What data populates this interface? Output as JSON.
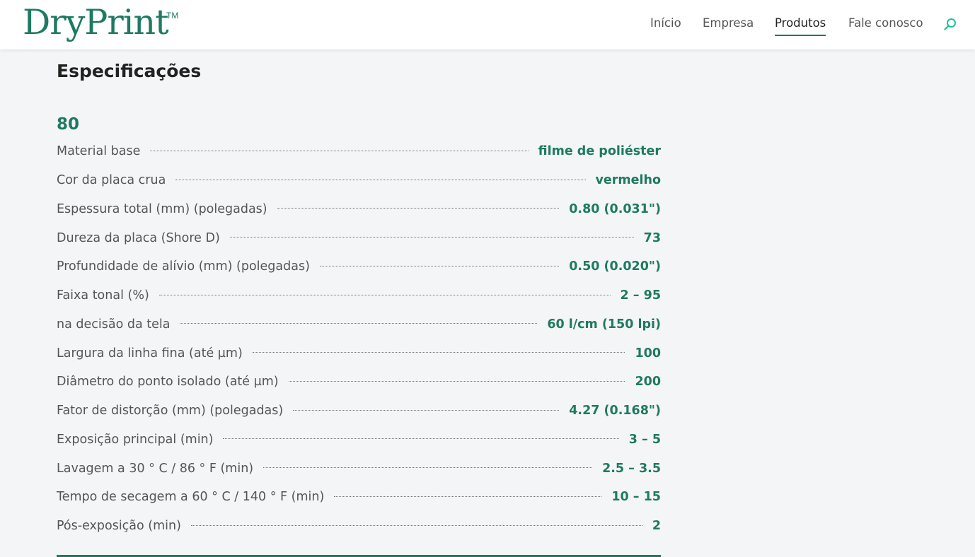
{
  "header": {
    "logo": "DryPrint",
    "trademark": "TM",
    "nav": [
      {
        "label": "Início",
        "active": false
      },
      {
        "label": "Empresa",
        "active": false
      },
      {
        "label": "Produtos",
        "active": true
      },
      {
        "label": "Fale conosco",
        "active": false
      }
    ],
    "search_icon": "search-icon"
  },
  "main": {
    "title": "Especificações",
    "variant": "80",
    "specs": [
      {
        "label": "Material base",
        "value": "filme de poliéster"
      },
      {
        "label": "Cor da placa crua",
        "value": "vermelho"
      },
      {
        "label": "Espessura total (mm) (polegadas)",
        "value": "0.80 (0.031\")"
      },
      {
        "label": "Dureza da placa (Shore D)",
        "value": "73"
      },
      {
        "label": "Profundidade de alívio (mm) (polegadas)",
        "value": "0.50 (0.020\")"
      },
      {
        "label": "Faixa tonal (%)",
        "value": "2 – 95"
      },
      {
        "label": "na decisão da tela",
        "value": "60 l/cm (150 lpi)"
      },
      {
        "label": "Largura da linha fina (até µm)",
        "value": "100"
      },
      {
        "label": "Diâmetro do ponto isolado (até µm)",
        "value": "200"
      },
      {
        "label": "Fator de distorção (mm) (polegadas)",
        "value": "4.27 (0.168\")"
      },
      {
        "label": "Exposição principal (min)",
        "value": "3 – 5"
      },
      {
        "label": "Lavagem a 30 ° C / 86 ° F (min)",
        "value": "2.5 – 3.5"
      },
      {
        "label": "Tempo de secagem a 60 ° C / 140 ° F (min)",
        "value": "10 – 15"
      },
      {
        "label": "Pós-exposição (min)",
        "value": "2"
      }
    ]
  },
  "colors": {
    "brand": "#1e7a61",
    "background": "#f4f5f7",
    "text": "#555555"
  }
}
